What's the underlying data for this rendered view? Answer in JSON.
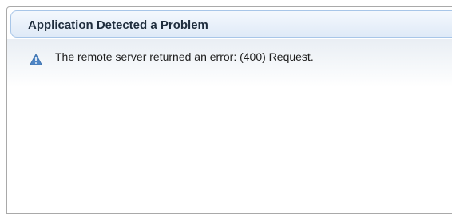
{
  "dialog": {
    "title": "Application Detected a Problem",
    "message": "The remote server returned an error: (400) Request.",
    "icon": "warning-icon",
    "accent_color": "#4f86c6"
  }
}
